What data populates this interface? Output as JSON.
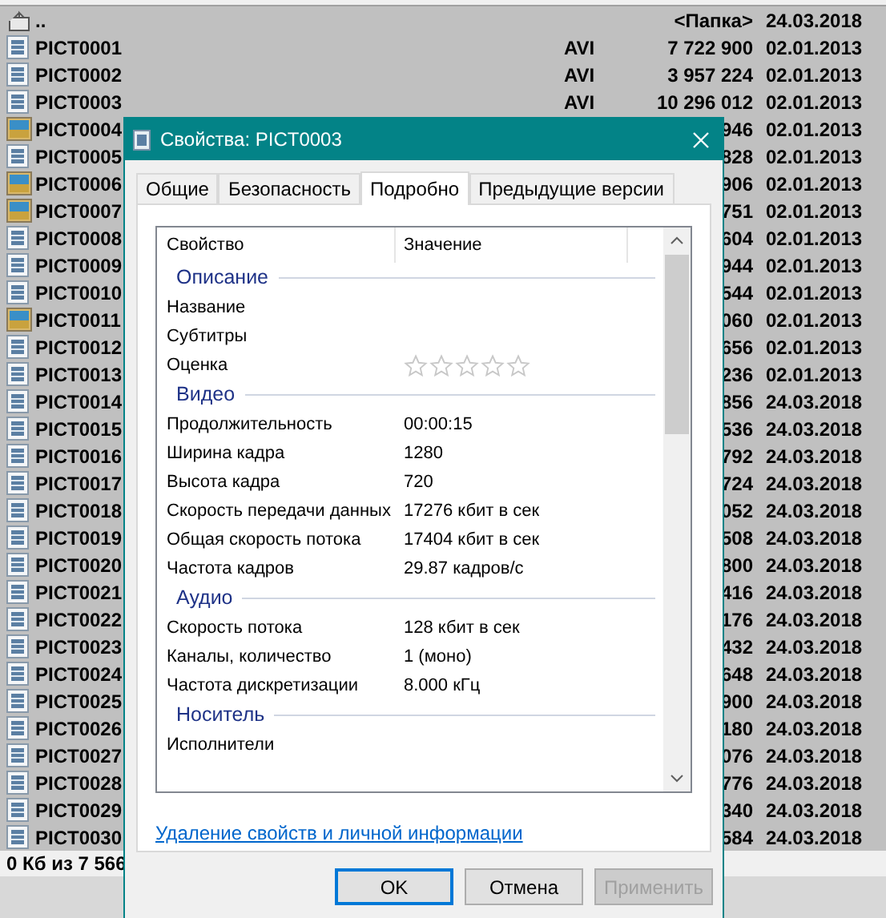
{
  "file_list": {
    "rows": [
      {
        "kind": "up",
        "name": "..",
        "type": "",
        "size": "<Папка>",
        "date": "24.03.2018"
      },
      {
        "kind": "video",
        "name": "PICT0001",
        "type": "AVI",
        "size": "7 722 900",
        "date": "02.01.2013"
      },
      {
        "kind": "video",
        "name": "PICT0002",
        "type": "AVI",
        "size": "3 957 224",
        "date": "02.01.2013"
      },
      {
        "kind": "video",
        "name": "PICT0003",
        "type": "AVI",
        "size": "10 296 012",
        "date": "02.01.2013"
      },
      {
        "kind": "image",
        "name": "PICT0004",
        "size": "946",
        "date": "02.01.2013"
      },
      {
        "kind": "video",
        "name": "PICT0005",
        "size": "828",
        "date": "02.01.2013"
      },
      {
        "kind": "image",
        "name": "PICT0006",
        "size": "906",
        "date": "02.01.2013"
      },
      {
        "kind": "image",
        "name": "PICT0007",
        "size": "751",
        "date": "02.01.2013"
      },
      {
        "kind": "video",
        "name": "PICT0008",
        "size": "604",
        "date": "02.01.2013"
      },
      {
        "kind": "video",
        "name": "PICT0009",
        "size": "944",
        "date": "02.01.2013"
      },
      {
        "kind": "video",
        "name": "PICT0010",
        "size": "544",
        "date": "02.01.2013"
      },
      {
        "kind": "image",
        "name": "PICT0011",
        "size": "060",
        "date": "02.01.2013"
      },
      {
        "kind": "video",
        "name": "PICT0012",
        "size": "656",
        "date": "02.01.2013"
      },
      {
        "kind": "video",
        "name": "PICT0013",
        "size": "236",
        "date": "02.01.2013"
      },
      {
        "kind": "video",
        "name": "PICT0014",
        "size": "856",
        "date": "24.03.2018"
      },
      {
        "kind": "video",
        "name": "PICT0015",
        "size": "536",
        "date": "24.03.2018"
      },
      {
        "kind": "video",
        "name": "PICT0016",
        "size": "792",
        "date": "24.03.2018"
      },
      {
        "kind": "video",
        "name": "PICT0017",
        "size": "724",
        "date": "24.03.2018"
      },
      {
        "kind": "video",
        "name": "PICT0018",
        "size": "052",
        "date": "24.03.2018"
      },
      {
        "kind": "video",
        "name": "PICT0019",
        "size": "508",
        "date": "24.03.2018"
      },
      {
        "kind": "video",
        "name": "PICT0020",
        "size": "800",
        "date": "24.03.2018"
      },
      {
        "kind": "video",
        "name": "PICT0021",
        "size": "416",
        "date": "24.03.2018"
      },
      {
        "kind": "video",
        "name": "PICT0022",
        "size": "176",
        "date": "24.03.2018"
      },
      {
        "kind": "video",
        "name": "PICT0023",
        "size": "432",
        "date": "24.03.2018"
      },
      {
        "kind": "video",
        "name": "PICT0024",
        "size": "648",
        "date": "24.03.2018"
      },
      {
        "kind": "video",
        "name": "PICT0025",
        "size": "900",
        "date": "24.03.2018"
      },
      {
        "kind": "video",
        "name": "PICT0026",
        "size": "180",
        "date": "24.03.2018"
      },
      {
        "kind": "video",
        "name": "PICT0027",
        "size": "076",
        "date": "24.03.2018"
      },
      {
        "kind": "video",
        "name": "PICT0028",
        "size": "776",
        "date": "24.03.2018"
      },
      {
        "kind": "video",
        "name": "PICT0029",
        "size": "340",
        "date": "24.03.2018"
      },
      {
        "kind": "video",
        "name": "PICT0030",
        "size": "584",
        "date": "24.03.2018"
      }
    ],
    "status": "0 Кб из 7 566"
  },
  "dialog": {
    "title": "Свойства: PICT0003",
    "tabs": [
      {
        "label": "Общие",
        "selected": false
      },
      {
        "label": "Безопасность",
        "selected": false
      },
      {
        "label": "Подробно",
        "selected": true
      },
      {
        "label": "Предыдущие версии",
        "selected": false
      }
    ],
    "columns": [
      "Свойство",
      "Значение"
    ],
    "groups": [
      {
        "title": "Описание",
        "rows": [
          {
            "kind": "text",
            "name": "Название"
          },
          {
            "kind": "text",
            "name": "Субтитры"
          },
          {
            "kind": "rating",
            "name": "Оценка",
            "stars": 0
          }
        ]
      },
      {
        "title": "Видео",
        "rows": [
          {
            "kind": "text",
            "name": "Продолжительность",
            "value": "00:00:15"
          },
          {
            "kind": "text",
            "name": "Ширина кадра",
            "value": "1280"
          },
          {
            "kind": "text",
            "name": "Высота кадра",
            "value": "720"
          },
          {
            "kind": "text",
            "name": "Скорость передачи данных",
            "value": "17276 кбит в сек"
          },
          {
            "kind": "text",
            "name": "Общая скорость потока",
            "value": "17404 кбит в сек"
          },
          {
            "kind": "text",
            "name": "Частота кадров",
            "value": "29.87 кадров/с"
          }
        ]
      },
      {
        "title": "Аудио",
        "rows": [
          {
            "kind": "text",
            "name": "Скорость потока",
            "value": "128 кбит в сек"
          },
          {
            "kind": "text",
            "name": "Каналы, количество",
            "value": "1 (моно)"
          },
          {
            "kind": "text",
            "name": "Частота дискретизации",
            "value": "8.000 кГц"
          }
        ]
      },
      {
        "title": "Носитель",
        "rows": [
          {
            "kind": "text",
            "name": "Исполнители"
          }
        ]
      }
    ],
    "link": "Удаление свойств и личной информации",
    "buttons": [
      {
        "label": "OK",
        "kind": "default",
        "disabled": false
      },
      {
        "label": "Отмена",
        "kind": "normal",
        "disabled": false
      },
      {
        "label": "Применить",
        "kind": "normal",
        "disabled": true
      }
    ]
  }
}
